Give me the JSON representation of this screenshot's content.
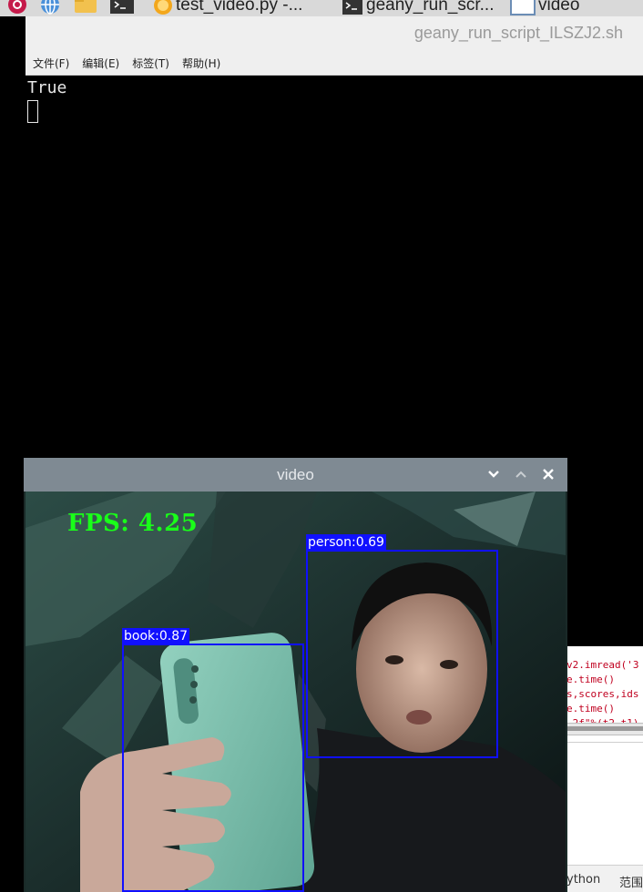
{
  "taskbar": {
    "items": [
      {
        "label": "test_video.py -...",
        "icon": "geany-icon"
      },
      {
        "label": "geany_run_scr...",
        "icon": "terminal-icon"
      },
      {
        "label": "video",
        "icon": "window-icon"
      }
    ],
    "launchers": [
      "raspberry-menu-icon",
      "browser-icon",
      "folder-icon",
      "terminal-icon"
    ]
  },
  "terminal": {
    "title": "geany_run_script_ILSZJ2.sh",
    "menu": [
      "文件(F)",
      "编辑(E)",
      "标签(T)",
      "帮助(H)"
    ],
    "output": "True"
  },
  "editor": {
    "code_lines": [
      "v2.imread('3",
      "e.time()",
      "s,scores,ids",
      "e.time()",
      ".2f\"%(t2-t1)"
    ],
    "status": [
      "ython",
      "范围"
    ]
  },
  "video_window": {
    "title": "video",
    "buttons": [
      "chevron-down-icon",
      "chevron-up-icon",
      "close-icon"
    ],
    "overlay": {
      "fps_text": "FPS: 4.25",
      "detections": [
        {
          "label": "person:0.69",
          "class": "person",
          "score": 0.69
        },
        {
          "label": "book:0.87",
          "class": "book",
          "score": 0.87
        }
      ]
    }
  }
}
